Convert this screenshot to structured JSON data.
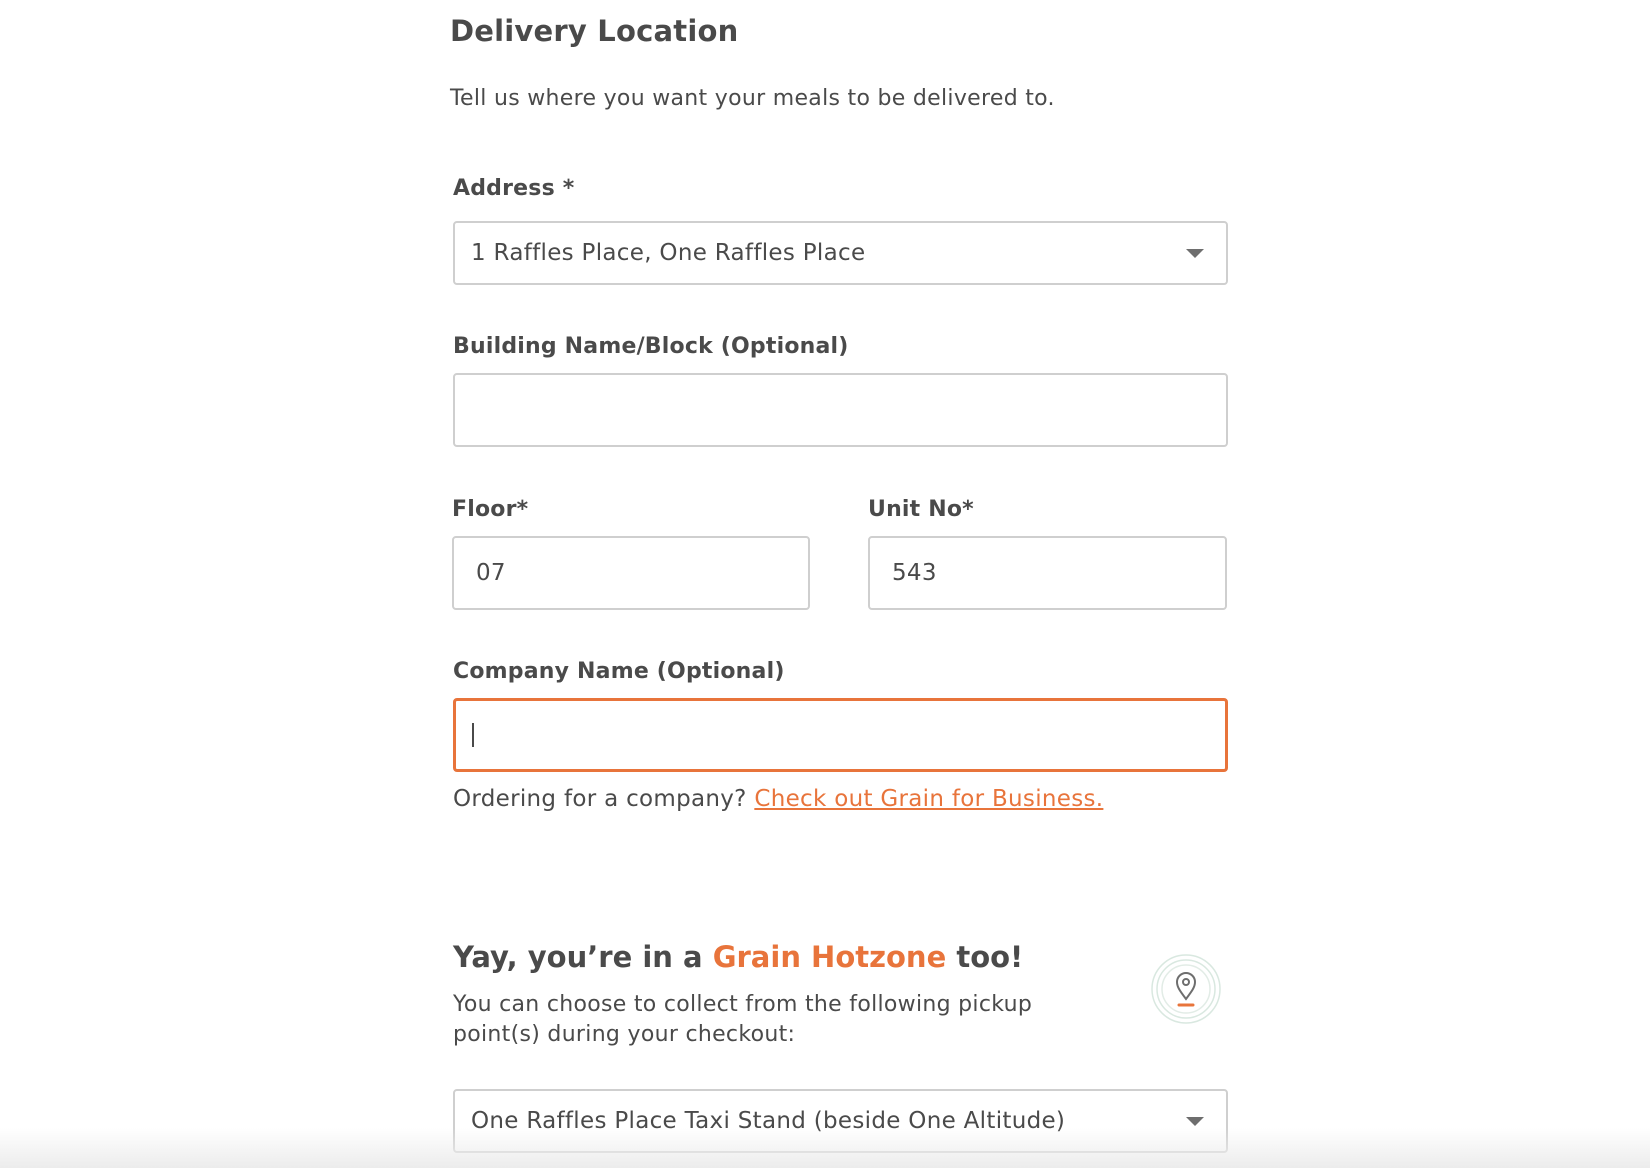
{
  "section": {
    "title": "Delivery Location",
    "intro": "Tell us where you want your meals to be delivered to."
  },
  "address": {
    "label": "Address *",
    "value": "1 Raffles Place, One Raffles Place"
  },
  "building": {
    "label": "Building Name/Block (Optional)",
    "value": ""
  },
  "floor": {
    "label": "Floor*",
    "value": "07"
  },
  "unit": {
    "label": "Unit No*",
    "value": "543"
  },
  "company": {
    "label": "Company Name (Optional)",
    "value": "",
    "helper_text": "Ordering for a company?",
    "helper_link": "Check out Grain for Business."
  },
  "hotzone": {
    "title_prefix": "Yay, you’re in a",
    "title_accent": "Grain Hotzone",
    "title_suffix": "too!",
    "description": "You can choose to collect from the following pickup point(s) during your checkout:",
    "icon": "location-pin-icon",
    "pickup_value": "One Raffles Place Taxi Stand (beside One Altitude)"
  },
  "colors": {
    "accent": "#e8743b",
    "text": "#4a4a4a",
    "border": "#cfcfcf"
  }
}
